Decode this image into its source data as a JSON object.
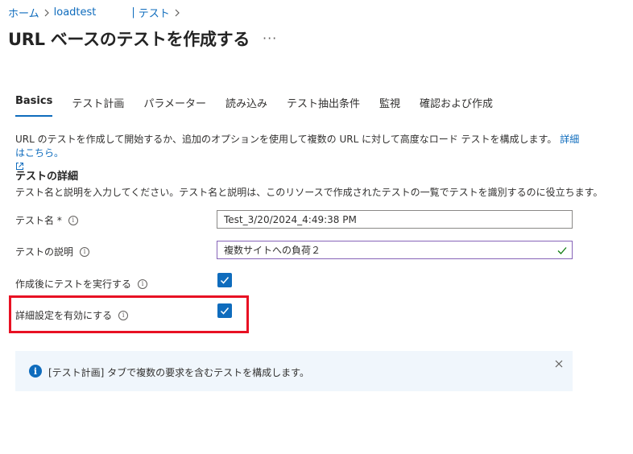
{
  "breadcrumb": {
    "home": "ホーム",
    "resource": "loadtest",
    "current": "テスト"
  },
  "page": {
    "title": "URL ベースのテストを作成する",
    "more": "···"
  },
  "tabs": [
    {
      "label": "Basics",
      "active": true
    },
    {
      "label": "テスト計画"
    },
    {
      "label": "パラメーター"
    },
    {
      "label": "読み込み"
    },
    {
      "label": "テスト抽出条件"
    },
    {
      "label": "監視"
    },
    {
      "label": "確認および作成"
    }
  ],
  "intro": {
    "text": "URL のテストを作成して開始するか、追加のオプションを使用して複数の URL に対して高度なロード テストを構成します。",
    "link": "詳細はこちら。"
  },
  "details": {
    "title": "テストの詳細",
    "description": "テスト名と説明を入力してください。テスト名と説明は、このリソースで作成されたテストの一覧でテストを識別するのに役立ちます。"
  },
  "form": {
    "test_name_label": "テスト名 *",
    "test_name_value": "Test_3/20/2024_4:49:38 PM",
    "test_desc_label": "テストの説明",
    "test_desc_value": "複数サイトへの負荷２",
    "run_after_create_label": "作成後にテストを実行する",
    "run_after_create_checked": true,
    "advanced_label": "詳細設定を有効にする",
    "advanced_checked": true
  },
  "banner": {
    "text": "[テスト計画] タブで複数の要求を含むテストを構成します。"
  },
  "colors": {
    "accent": "#0f6cbd",
    "highlight": "#e81123",
    "banner_bg": "#f0f6fc"
  }
}
